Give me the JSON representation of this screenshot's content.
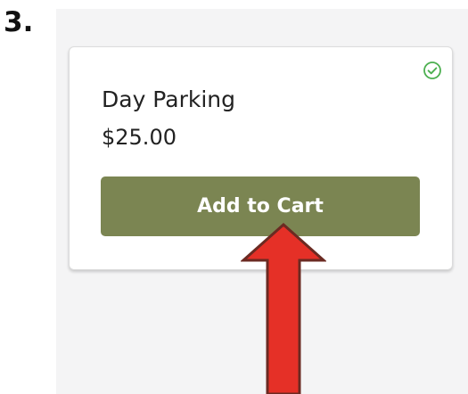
{
  "step": {
    "number": "3."
  },
  "product": {
    "name": "Day Parking",
    "price": "$25.00",
    "selected": true,
    "add_button_label": "Add to Cart"
  },
  "icons": {
    "selected_indicator": "check-circle-icon",
    "pointer": "red-arrow-annotation"
  },
  "colors": {
    "button": "#7b8552",
    "check": "#4caf50",
    "arrow": "#e53027",
    "screen_background": "#f4f4f5"
  }
}
